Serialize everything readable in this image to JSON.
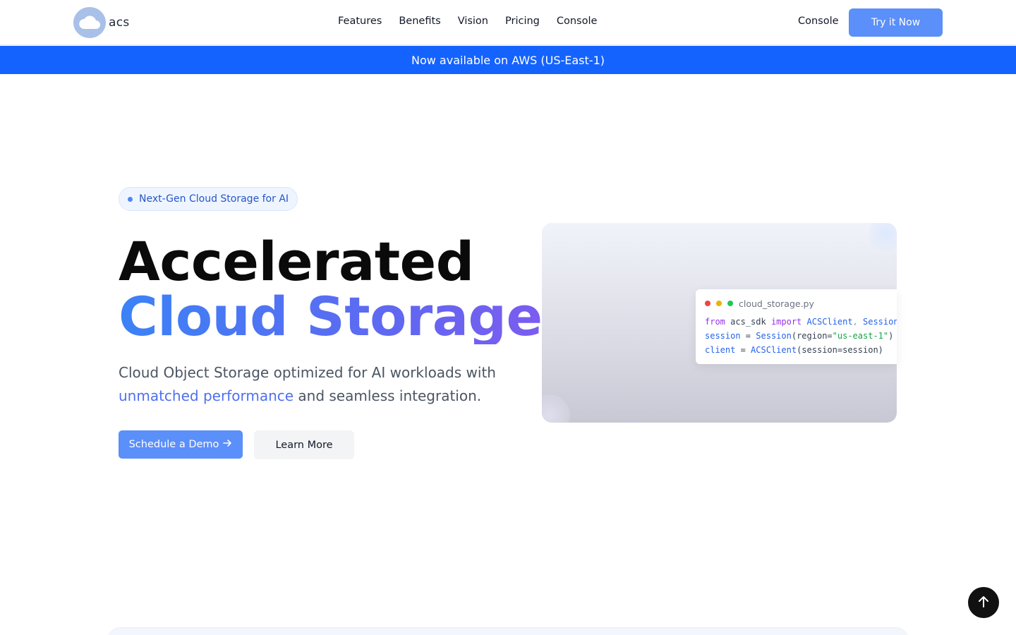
{
  "header": {
    "logo_text": "acs",
    "nav": [
      {
        "label": "Features"
      },
      {
        "label": "Benefits"
      },
      {
        "label": "Vision"
      },
      {
        "label": "Pricing"
      },
      {
        "label": "Console"
      }
    ],
    "console_label": "Console",
    "cta_label": "Try it Now"
  },
  "announcement": {
    "text": "Now available on AWS (US-East-1)"
  },
  "hero": {
    "badge": "Next-Gen Cloud Storage for AI",
    "title_line1": "Accelerated",
    "title_line2": "Cloud Storage",
    "subtitle_before": "Cloud Object Storage optimized for AI workloads with ",
    "subtitle_highlight": "unmatched performance",
    "subtitle_after": " and seamless integration.",
    "primary_cta": "Schedule a Demo",
    "secondary_cta": "Learn More"
  },
  "code_card": {
    "filename": "cloud_storage.py",
    "line1": {
      "kw_from": "from",
      "module": " acs_sdk ",
      "kw_import": "import",
      "cls1": " ACSClient",
      "sep": ", ",
      "cls2": "Session"
    },
    "line2": {
      "var": "session",
      "eq": " = ",
      "cls": "Session",
      "open": "(region=",
      "str": "\"us-east-1\"",
      "close": ")"
    },
    "line3": {
      "var": "client",
      "eq": " = ",
      "cls": "ACSClient",
      "args": "(session=session)"
    }
  },
  "colors": {
    "primary": "#5b8ff9",
    "announcement_bg": "#1463ff",
    "dot_red": "#ef4444",
    "dot_yellow": "#eab308",
    "dot_green": "#22c55e"
  },
  "icons": {
    "logo": "cloud-icon",
    "demo_arrow": "arrow-right-icon",
    "scroll_top": "arrow-up-icon"
  }
}
